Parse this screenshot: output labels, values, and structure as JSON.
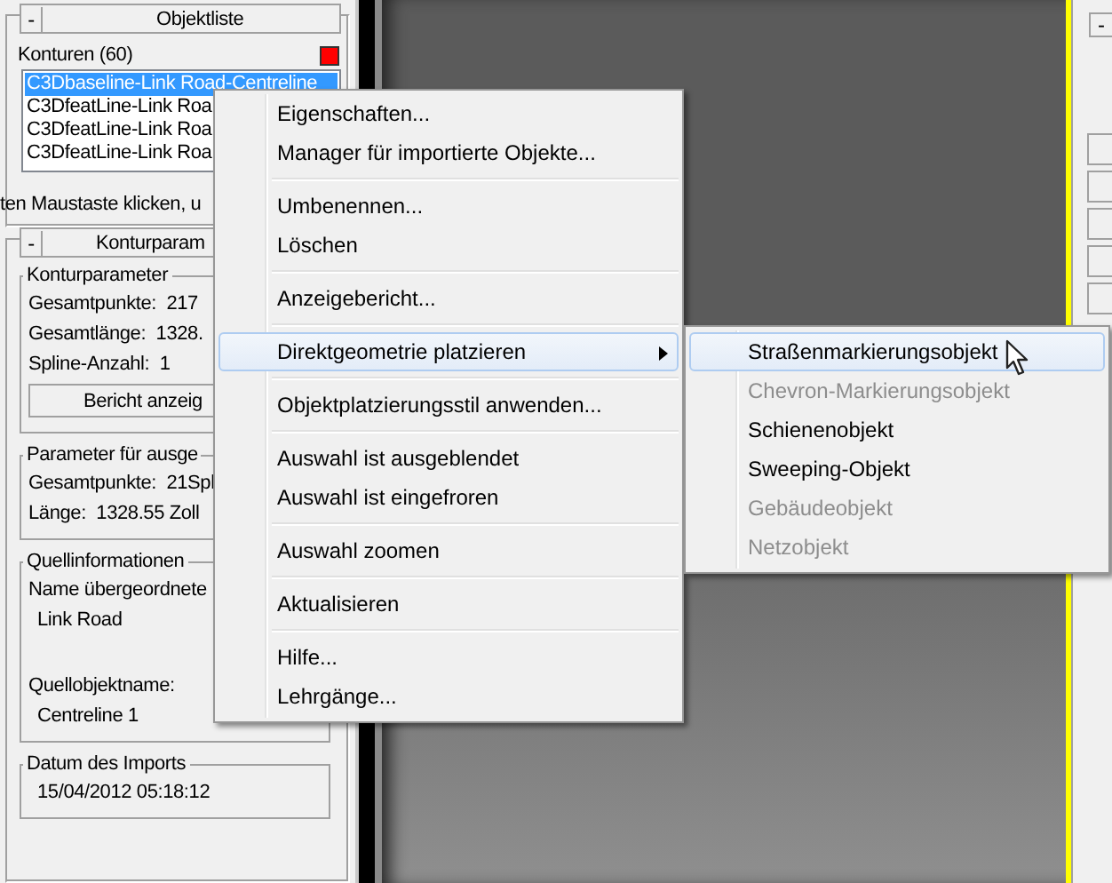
{
  "object_list": {
    "collapse": "-",
    "title": "Objektliste",
    "count_label": "Konturen (60)",
    "items": [
      {
        "text": "C3Dbaseline-Link Road-Centreline",
        "selected": true
      },
      {
        "text": "C3DfeatLine-Link Roa",
        "selected": false
      },
      {
        "text": "C3DfeatLine-Link Roa",
        "selected": false
      },
      {
        "text": "C3DfeatLine-Link Roa",
        "selected": false
      }
    ],
    "hint": "ten Maustaste klicken, u"
  },
  "contour_panel": {
    "collapse": "-",
    "title": "Konturparam",
    "groups": [
      {
        "title": "Konturparameter",
        "rows": [
          {
            "kind": "text",
            "text": "Gesamtpunkte:  217"
          },
          {
            "kind": "text",
            "text": "Gesamtlänge:  1328."
          },
          {
            "kind": "text",
            "text": "Spline-Anzahl:  1"
          }
        ],
        "button": "Bericht anzeig"
      },
      {
        "title": "Parameter für ausge",
        "rows": [
          {
            "kind": "text",
            "text": "Gesamtpunkte:  21Spl"
          },
          {
            "kind": "text",
            "text": "Länge:  1328.55 Zoll"
          }
        ]
      },
      {
        "title": "Quellinformationen",
        "rows": [
          {
            "kind": "text",
            "text": "Name übergeordnete"
          },
          {
            "kind": "value",
            "text": "Link Road"
          },
          {
            "kind": "text",
            "text": "Quellobjektname:"
          },
          {
            "kind": "value",
            "text": "Centreline 1"
          }
        ]
      },
      {
        "title": "Datum des Imports",
        "rows": [
          {
            "kind": "value",
            "text": "15/04/2012 05:18:12"
          }
        ]
      }
    ]
  },
  "right_panel": {
    "collapse": "-"
  },
  "context_menu": {
    "groups": [
      [
        {
          "label": "Eigenschaften...",
          "selected": false,
          "submenu": false
        },
        {
          "label": "Manager für importierte Objekte...",
          "selected": false,
          "submenu": false
        }
      ],
      [
        {
          "label": "Umbenennen...",
          "selected": false,
          "submenu": false
        },
        {
          "label": "Löschen",
          "selected": false,
          "submenu": false
        }
      ],
      [
        {
          "label": "Anzeigebericht...",
          "selected": false,
          "submenu": false
        }
      ],
      [
        {
          "label": "Direktgeometrie platzieren",
          "selected": true,
          "submenu": true
        }
      ],
      [
        {
          "label": "Objektplatzierungsstil anwenden...",
          "selected": false,
          "submenu": false
        }
      ],
      [
        {
          "label": "Auswahl ist ausgeblendet",
          "selected": false,
          "submenu": false
        },
        {
          "label": "Auswahl ist eingefroren",
          "selected": false,
          "submenu": false
        }
      ],
      [
        {
          "label": "Auswahl zoomen",
          "selected": false,
          "submenu": false
        }
      ],
      [
        {
          "label": "Aktualisieren",
          "selected": false,
          "submenu": false
        }
      ],
      [
        {
          "label": "Hilfe...",
          "selected": false,
          "submenu": false
        },
        {
          "label": "Lehrgänge...",
          "selected": false,
          "submenu": false
        }
      ]
    ]
  },
  "submenu": {
    "items": [
      {
        "label": "Straßenmarkierungsobjekt",
        "selected": true,
        "disabled": false
      },
      {
        "label": "Chevron-Markierungsobjekt",
        "selected": false,
        "disabled": true
      },
      {
        "label": "Schienenobjekt",
        "selected": false,
        "disabled": false
      },
      {
        "label": "Sweeping-Objekt",
        "selected": false,
        "disabled": false
      },
      {
        "label": "Gebäudeobjekt",
        "selected": false,
        "disabled": true
      },
      {
        "label": "Netzobjekt",
        "selected": false,
        "disabled": true
      }
    ]
  }
}
